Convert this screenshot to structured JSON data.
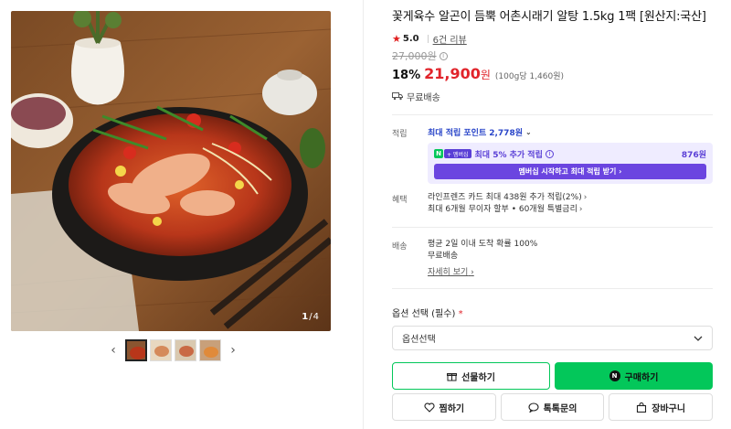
{
  "gallery": {
    "counter_current": "1",
    "counter_total": "/4",
    "prev_icon": "chevron-left-icon",
    "next_icon": "chevron-right-icon"
  },
  "product": {
    "title": "꽃게육수 알곤이 듬뿍 어촌시래기 알탕 1.5kg 1팩 [원산지:국산]",
    "rating_score": "5.0",
    "review_count": "6건 리뷰",
    "original_price": "27,000원",
    "discount_rate": "18%",
    "sale_price": "21,900",
    "price_unit": "원",
    "unit_price": "(100g당 1,460원)",
    "shipping": "무료배송"
  },
  "points": {
    "label": "적립",
    "head": "최대 적립 포인트",
    "head_amount": "2,778원",
    "badge_n": "N",
    "badge_plus": "+ 멤버십",
    "member_text": "최대 5% 추가 적립",
    "member_amount": "876원",
    "member_cta": "멤버십 시작하고 최대 적립 받기 ›"
  },
  "benefits": {
    "label": "혜택",
    "line1": "라인프렌즈 카드 최대 438원 추가 적립(2%)",
    "line2": "최대 6개월 무이자 할부 • 60개월 특별금리"
  },
  "delivery": {
    "label": "배송",
    "line1": "평균 2일 이내 도착 확률 100%",
    "line2": "무료배송",
    "more": "자세히 보기"
  },
  "options": {
    "label": "옵션 선택 (필수)",
    "required_mark": "*",
    "select_value": "옵션선택"
  },
  "actions": {
    "gift": "선물하기",
    "buy": "구매하기",
    "wish": "찜하기",
    "talk": "톡톡문의",
    "cart": "장바구니"
  },
  "colors": {
    "accent_green": "#03c75a",
    "price_red": "#e1242b",
    "member_purple": "#6b45e0"
  }
}
